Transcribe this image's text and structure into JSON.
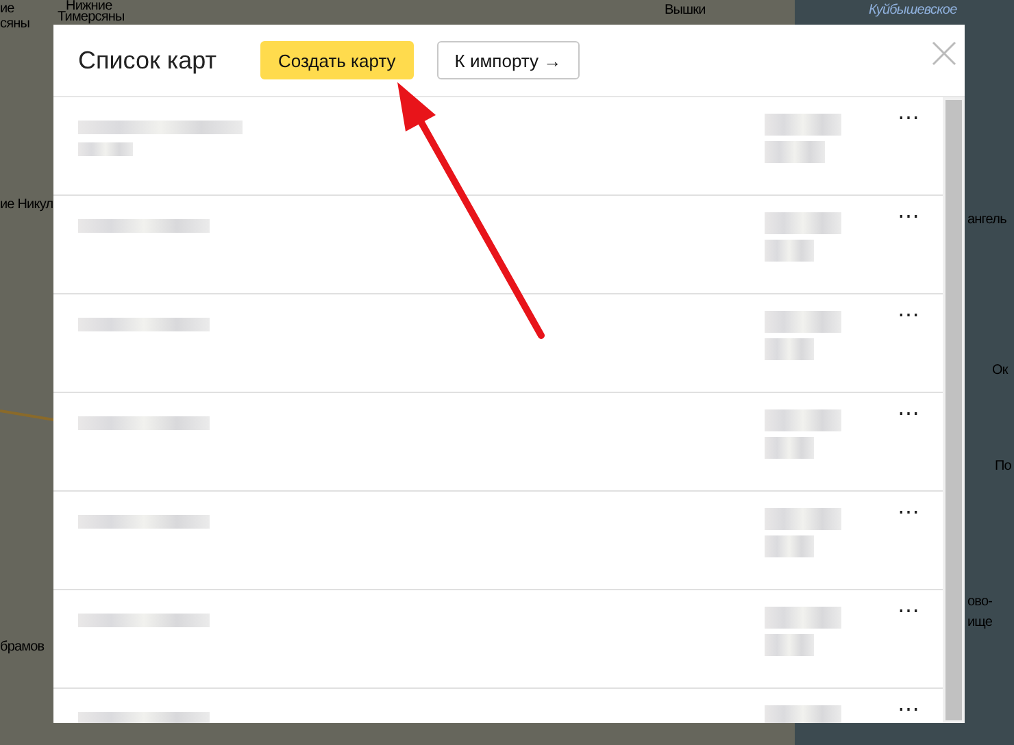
{
  "map": {
    "labels": [
      {
        "text": "ие"
      },
      {
        "text": "сяны"
      },
      {
        "text": "Нижние"
      },
      {
        "text": "Тимерсяны"
      },
      {
        "text": "Вышки"
      },
      {
        "text": "Куйбышевское",
        "kind": "water"
      },
      {
        "text": "ие Никул"
      },
      {
        "text": "брамов"
      },
      {
        "text": "ангель"
      },
      {
        "text": "Ок"
      },
      {
        "text": "По"
      },
      {
        "text": "ово-"
      },
      {
        "text": "ище"
      }
    ]
  },
  "dialog": {
    "title": "Список карт",
    "buttons": [
      {
        "label": "Создать карту",
        "kind": "primary"
      },
      {
        "label": "К импорту →",
        "kind": "secondary"
      }
    ],
    "rows": [
      {
        "menu": "⋯"
      },
      {
        "menu": "⋯"
      },
      {
        "menu": "⋯"
      },
      {
        "menu": "⋯"
      },
      {
        "menu": "⋯"
      },
      {
        "menu": "⋯"
      },
      {
        "menu": "⋯"
      }
    ]
  }
}
